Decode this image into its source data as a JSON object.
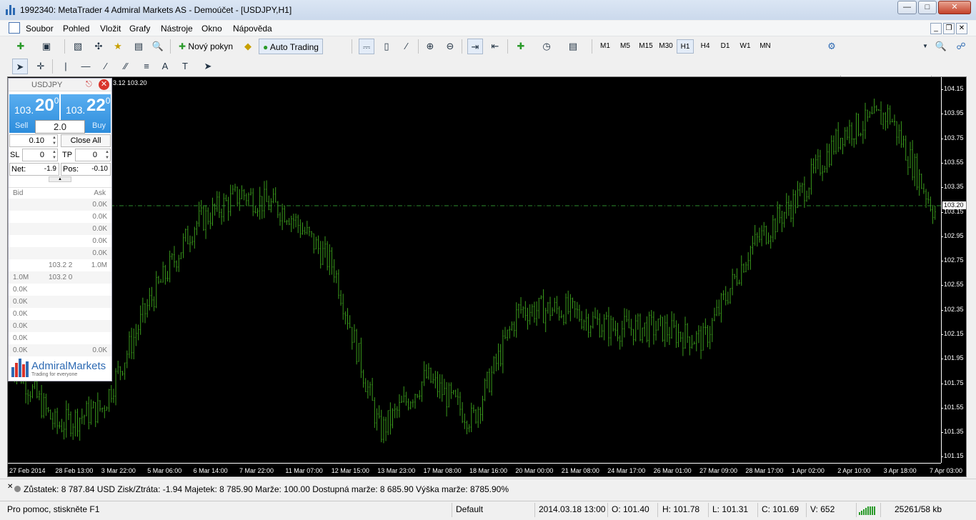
{
  "window": {
    "title": "1992340: MetaTrader 4 Admiral Markets AS - Demoúčet - [USDJPY,H1]"
  },
  "menu": [
    "Soubor",
    "Pohled",
    "Vložit",
    "Grafy",
    "Nástroje",
    "Okno",
    "Nápověda"
  ],
  "toolbar": {
    "new_order": "Nový pokyn",
    "auto_trading": "Auto Trading",
    "timeframes": [
      "M1",
      "M5",
      "M15",
      "M30",
      "H1",
      "H4",
      "D1",
      "W1",
      "MN"
    ],
    "selected_timeframe": "H1"
  },
  "chart": {
    "info": "3.12 103.20",
    "current_price": "103.20",
    "price_ticks": [
      "104.15",
      "103.95",
      "103.75",
      "103.55",
      "103.35",
      "103.15",
      "102.95",
      "102.75",
      "102.55",
      "102.35",
      "102.15",
      "101.95",
      "101.75",
      "101.55",
      "101.35",
      "101.15"
    ],
    "time_ticks": [
      "27 Feb 2014",
      "28 Feb 13:00",
      "3 Mar 22:00",
      "5 Mar 06:00",
      "6 Mar 14:00",
      "7 Mar 22:00",
      "11 Mar 07:00",
      "12 Mar 15:00",
      "13 Mar 23:00",
      "17 Mar 08:00",
      "18 Mar 16:00",
      "20 Mar 00:00",
      "21 Mar 08:00",
      "24 Mar 17:00",
      "26 Mar 01:00",
      "27 Mar 09:00",
      "28 Mar 17:00",
      "1 Apr 02:00",
      "2 Apr 10:00",
      "3 Apr 18:00",
      "7 Apr 03:00"
    ],
    "bar_color": "#3a9a1c",
    "level_color": "#2e8b2e"
  },
  "chart_data": {
    "type": "bar",
    "title": "",
    "xlabel": "",
    "ylabel": "",
    "x": [
      "27 Feb 2014",
      "28 Feb 13:00",
      "3 Mar 22:00",
      "5 Mar 06:00",
      "6 Mar 14:00",
      "7 Mar 22:00",
      "11 Mar 07:00",
      "12 Mar 15:00",
      "13 Mar 23:00",
      "17 Mar 08:00",
      "18 Mar 16:00",
      "20 Mar 00:00",
      "21 Mar 08:00",
      "24 Mar 17:00",
      "26 Mar 01:00",
      "27 Mar 09:00",
      "28 Mar 17:00",
      "1 Apr 02:00",
      "2 Apr 10:00",
      "3 Apr 18:00",
      "7 Apr 03:00"
    ],
    "series": [
      {
        "values": [
          101.95,
          101.4,
          101.55,
          102.4,
          103.05,
          103.3,
          103.15,
          102.7,
          101.35,
          101.8,
          101.45,
          102.35,
          102.35,
          102.2,
          102.2,
          102.1,
          102.85,
          103.25,
          103.8,
          103.95,
          103.15
        ]
      }
    ],
    "ylim": [
      101.1,
      104.25
    ],
    "grid": false
  },
  "oneclick": {
    "symbol": "USDJPY",
    "sell_prefix": "103.",
    "sell_big": "20",
    "sell_sup": "0",
    "buy_prefix": "103.",
    "buy_big": "22",
    "buy_sup": "0",
    "sell_label": "Sell",
    "buy_label": "Buy",
    "volume": "2.0",
    "lot": "0.10",
    "close_all": "Close All",
    "sl_label": "SL",
    "sl_value": "0",
    "tp_label": "TP",
    "tp_value": "0",
    "net_label": "Net:",
    "net_value": "-1.9",
    "pos_label": "Pos:",
    "pos_value": "-0.10"
  },
  "dom": {
    "bid_header": "Bid",
    "ask_header": "Ask",
    "rows": [
      {
        "bid_vol": "",
        "price": "",
        "ask_vol": "0.0K"
      },
      {
        "bid_vol": "",
        "price": "",
        "ask_vol": "0.0K"
      },
      {
        "bid_vol": "",
        "price": "",
        "ask_vol": "0.0K"
      },
      {
        "bid_vol": "",
        "price": "",
        "ask_vol": "0.0K"
      },
      {
        "bid_vol": "",
        "price": "",
        "ask_vol": "0.0K"
      },
      {
        "bid_vol": "",
        "price": "103.2 2",
        "ask_vol": "1.0M"
      },
      {
        "bid_vol": "1.0M",
        "price": "103.2 0",
        "ask_vol": ""
      },
      {
        "bid_vol": "0.0K",
        "price": "",
        "ask_vol": ""
      },
      {
        "bid_vol": "0.0K",
        "price": "",
        "ask_vol": ""
      },
      {
        "bid_vol": "0.0K",
        "price": "",
        "ask_vol": ""
      },
      {
        "bid_vol": "0.0K",
        "price": "",
        "ask_vol": ""
      },
      {
        "bid_vol": "0.0K",
        "price": "",
        "ask_vol": ""
      },
      {
        "bid_vol": "0.0K",
        "price": "",
        "ask_vol": "0.0K"
      }
    ]
  },
  "logo": {
    "name": "AdmiralMarkets",
    "tagline": "Trading for everyone"
  },
  "terminal": {
    "summary": "Zůstatek: 8 787.84 USD  Zisk/Ztráta: -1.94  Majetek: 8 785.90  Marže: 100.00  Dostupná marže: 8 685.90  Výška marže: 8785.90%"
  },
  "status": {
    "help": "Pro pomoc, stiskněte F1",
    "profile": "Default",
    "datetime": "2014.03.18 13:00",
    "open": "O: 101.40",
    "high": "H: 101.78",
    "low": "L: 101.31",
    "close": "C: 101.69",
    "volume": "V: 652",
    "traffic": "25261/58 kb"
  }
}
